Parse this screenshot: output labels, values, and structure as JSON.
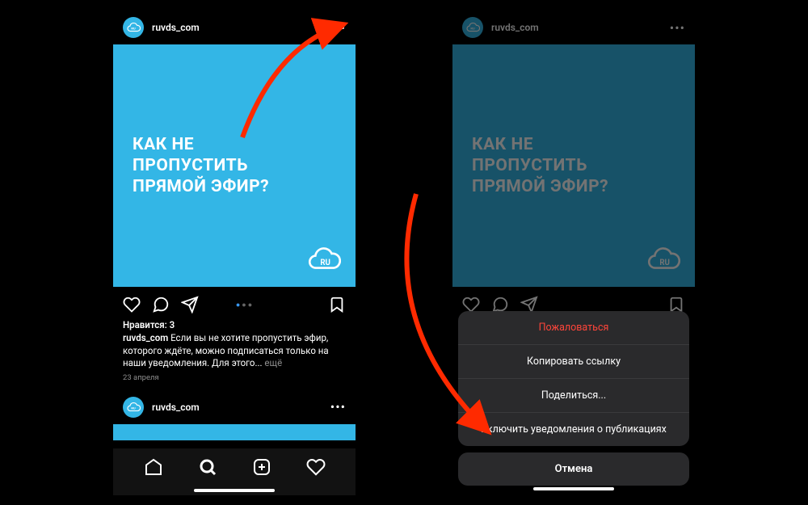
{
  "left": {
    "username": "ruvds_com",
    "postTitle": "КАК НЕ\nПРОПУСТИТЬ\nПРЯМОЙ ЭФИР?",
    "likes": "Нравится: 3",
    "captionUser": "ruvds_com",
    "captionText": " Если вы не хотите пропустить эфир, которого ждёте, можно подписаться только на наши уведомления. Для этого... ",
    "more": "ещё",
    "date": "23 апреля",
    "secondUsername": "ruvds_com"
  },
  "right": {
    "username": "ruvds_com",
    "postTitle": "КАК НЕ\nПРОПУСТИТЬ\nПРЯМОЙ ЭФИР?",
    "sheet": {
      "report": "Пожаловаться",
      "copy": "Копировать ссылку",
      "share": "Поделиться...",
      "notify": "Включить уведомления о публикациях",
      "cancel": "Отмена"
    }
  },
  "colors": {
    "brand": "#33b6e6",
    "danger": "#ff453a",
    "arrow": "#ff2a00"
  }
}
